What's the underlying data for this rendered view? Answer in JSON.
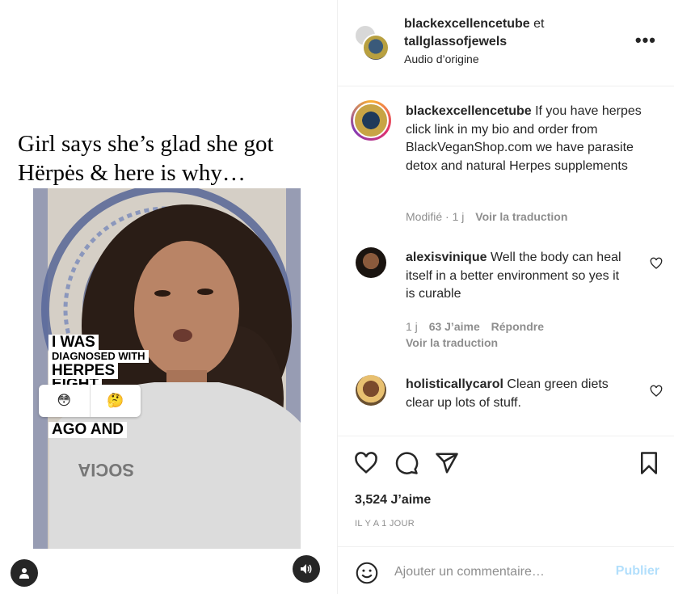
{
  "media": {
    "overlay_caption_line1": "Girl says she’s glad she got",
    "overlay_caption_line2": "Hërpės & here is why…",
    "video_text": {
      "line1": "I WAS",
      "line2": "DIAGNOSED WITH",
      "line3": "HERPES",
      "line4": "EIGHT",
      "line5": "AGO AND"
    },
    "emojis": [
      "😳",
      "🤔"
    ],
    "shirt_text": "SOCIA"
  },
  "post_header": {
    "author1": "blackexcellencetube",
    "joiner": "et",
    "author2": "tallglassofjewels",
    "audio": "Audio d’origine",
    "more_icon": "•••"
  },
  "caption": {
    "username": "blackexcellencetube",
    "text": "If you have herpes click link in my bio and order from BlackVeganShop.com we have parasite detox and natural Herpes supplements",
    "edited": "Modifié",
    "time": "1 j",
    "translate": "Voir la traduction"
  },
  "comments": [
    {
      "username": "alexisvinique",
      "text": "Well the body can heal itself in a better environment so yes it is curable",
      "time": "1 j",
      "likes": "63 J’aime",
      "reply": "Répondre",
      "translate": "Voir la traduction"
    },
    {
      "username": "holisticallycarol",
      "text": "Clean green diets clear up lots of stuff."
    }
  ],
  "actions": {
    "likes": "3,524 J’aime",
    "ago": "IL Y A 1 JOUR"
  },
  "add_comment": {
    "placeholder": "Ajouter un commentaire…",
    "publish": "Publier"
  },
  "colors": {
    "text": "#262626",
    "secondary": "#8e8e8e",
    "publish_disabled": "#b2dffc",
    "border": "#efefef"
  }
}
